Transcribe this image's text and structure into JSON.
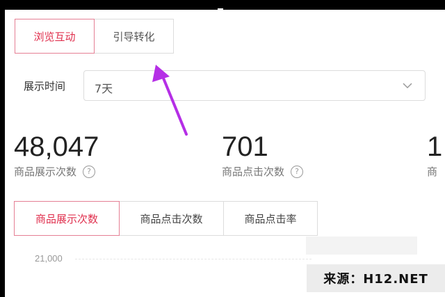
{
  "mode_tabs": [
    {
      "label": "浏览互动",
      "active": true
    },
    {
      "label": "引导转化",
      "active": false
    }
  ],
  "filter": {
    "label": "展示时间",
    "value": "7天"
  },
  "stats": [
    {
      "value": "48,047",
      "label": "商品展示次数"
    },
    {
      "value": "701",
      "label": "商品点击次数"
    },
    {
      "value": "1",
      "label": "商"
    }
  ],
  "metric_tabs": [
    {
      "label": "商品展示次数",
      "active": true
    },
    {
      "label": "商品点击次数",
      "active": false
    },
    {
      "label": "商品点击率",
      "active": false
    }
  ],
  "chart": {
    "y_tick": "21,000"
  },
  "watermark": {
    "text": "来源：H12.NET"
  },
  "colors": {
    "accent": "#e0304e",
    "accent_border": "#e57f94",
    "annotation_arrow": "#b52fe6"
  },
  "icons": {
    "help": "question-circle-icon",
    "chevron": "chevron-down-icon"
  }
}
